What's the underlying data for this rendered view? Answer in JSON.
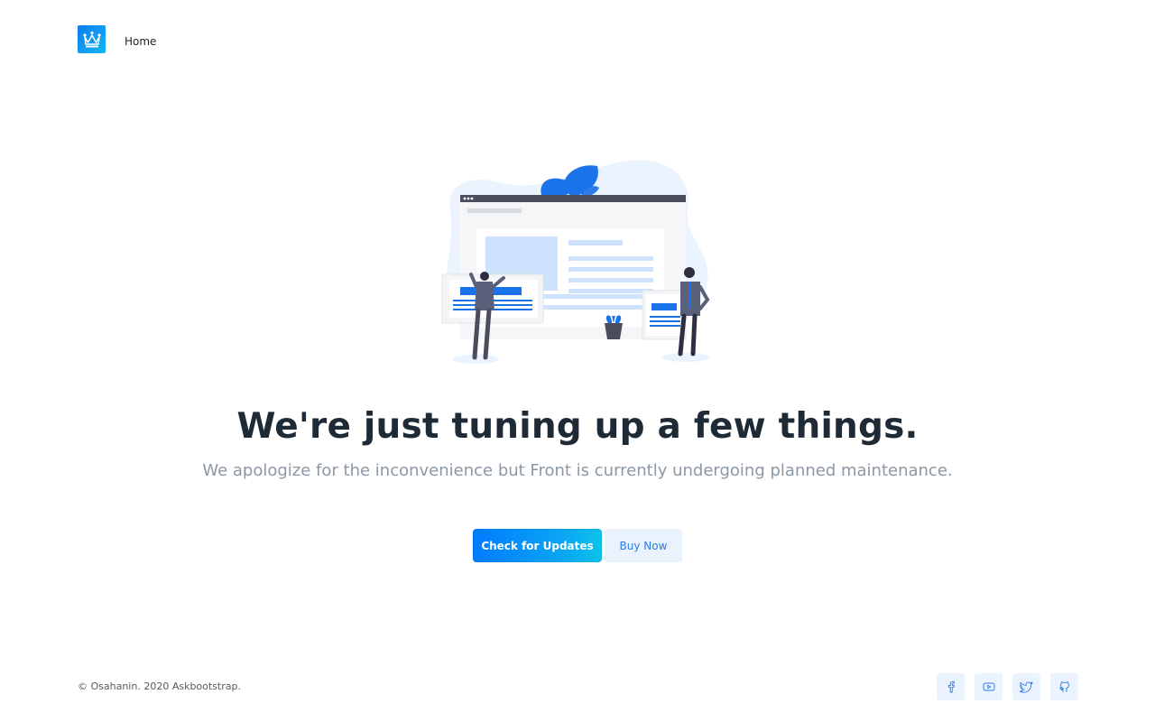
{
  "header": {
    "logo_icon": "crown-icon",
    "nav": {
      "home_label": "Home"
    }
  },
  "hero": {
    "illustration": "maintenance-illustration",
    "title": "We're just tuning up a few things.",
    "subtitle": "We apologize for the inconvenience but Front is currently undergoing planned maintenance."
  },
  "actions": {
    "primary_label": "Check for Updates",
    "secondary_label": "Buy Now"
  },
  "footer": {
    "copyright": "© Osahanin. 2020 Askbootstrap.",
    "socials": [
      {
        "icon": "facebook-icon"
      },
      {
        "icon": "youtube-icon"
      },
      {
        "icon": "twitter-icon"
      },
      {
        "icon": "github-icon"
      }
    ]
  },
  "colors": {
    "accent": "#007bff",
    "accent_soft": "#e9f2fd",
    "title": "#1e2a35",
    "muted": "#8c98a4"
  }
}
